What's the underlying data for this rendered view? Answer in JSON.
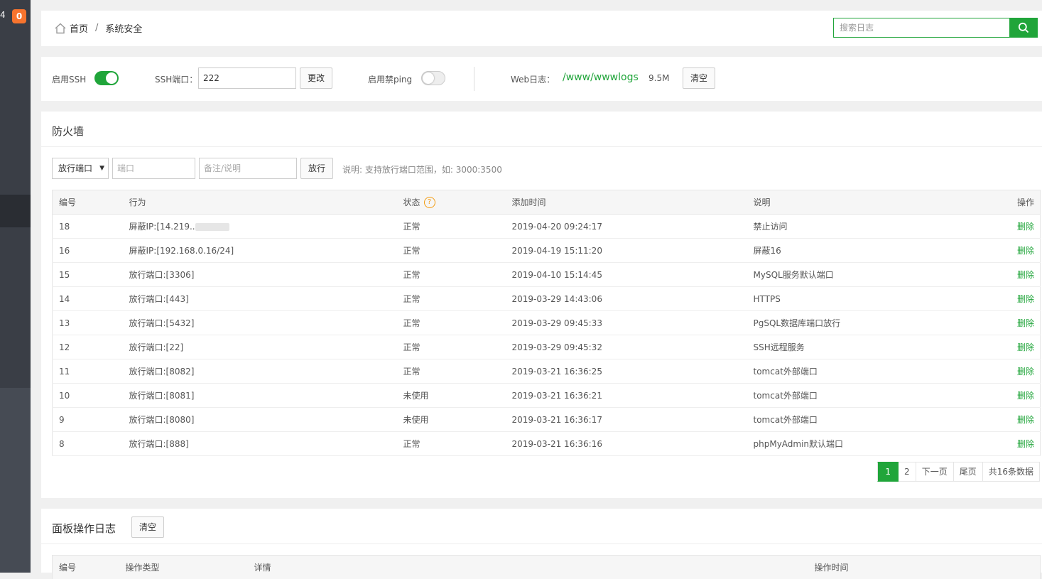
{
  "sidebar": {
    "digit": "4",
    "badge": "0"
  },
  "breadcrumb": {
    "home": "首页",
    "separator": "/",
    "current": "系统安全"
  },
  "search": {
    "placeholder": "搜索日志"
  },
  "settings": {
    "ssh_label": "启用SSH",
    "ssh_enabled": true,
    "port_label": "SSH端口：",
    "port_value": "222",
    "change_button": "更改",
    "ping_label": "启用禁ping",
    "ping_enabled": false,
    "weblog_label": "Web日志：",
    "weblog_path": "/www/wwwlogs",
    "weblog_size": "9.5M",
    "clear_button": "清空"
  },
  "firewall": {
    "title": "防火墙",
    "type_select": "放行端口",
    "port_placeholder": "端口",
    "note_placeholder": "备注/说明",
    "allow_button": "放行",
    "hint": "说明: 支持放行端口范围，如: 3000:3500",
    "columns": [
      "编号",
      "行为",
      "状态",
      "添加时间",
      "说明",
      "操作"
    ],
    "rows": [
      {
        "id": "18",
        "action": "屏蔽IP:[14.219..",
        "status": "正常",
        "time": "2019-04-20 09:24:17",
        "note": "禁止访问",
        "op": "删除"
      },
      {
        "id": "16",
        "action": "屏蔽IP:[192.168.0.16/24]",
        "status": "正常",
        "time": "2019-04-19 15:11:20",
        "note": "屏蔽16",
        "op": "删除"
      },
      {
        "id": "15",
        "action": "放行端口:[3306]",
        "status": "正常",
        "time": "2019-04-10 15:14:45",
        "note": "MySQL服务默认端口",
        "op": "删除"
      },
      {
        "id": "14",
        "action": "放行端口:[443]",
        "status": "正常",
        "time": "2019-03-29 14:43:06",
        "note": "HTTPS",
        "op": "删除"
      },
      {
        "id": "13",
        "action": "放行端口:[5432]",
        "status": "正常",
        "time": "2019-03-29 09:45:33",
        "note": "PgSQL数据库端口放行",
        "op": "删除"
      },
      {
        "id": "12",
        "action": "放行端口:[22]",
        "status": "正常",
        "time": "2019-03-29 09:45:32",
        "note": "SSH远程服务",
        "op": "删除"
      },
      {
        "id": "11",
        "action": "放行端口:[8082]",
        "status": "正常",
        "time": "2019-03-21 16:36:25",
        "note": "tomcat外部端口",
        "op": "删除"
      },
      {
        "id": "10",
        "action": "放行端口:[8081]",
        "status": "未使用",
        "time": "2019-03-21 16:36:21",
        "note": "tomcat外部端口",
        "op": "删除"
      },
      {
        "id": "9",
        "action": "放行端口:[8080]",
        "status": "未使用",
        "time": "2019-03-21 16:36:17",
        "note": "tomcat外部端口",
        "op": "删除"
      },
      {
        "id": "8",
        "action": "放行端口:[888]",
        "status": "正常",
        "time": "2019-03-21 16:36:16",
        "note": "phpMyAdmin默认端口",
        "op": "删除"
      }
    ],
    "pagination": {
      "current": "1",
      "page2": "2",
      "next": "下一页",
      "last": "尾页",
      "total": "共16条数据"
    }
  },
  "oplog": {
    "title": "面板操作日志",
    "clear_button": "清空",
    "columns": [
      "编号",
      "操作类型",
      "详情",
      "操作时间"
    ]
  },
  "colors": {
    "accent": "#20a53a",
    "sidebar": "#3a3e46",
    "badge": "#f7742e",
    "help": "#f39c12"
  }
}
